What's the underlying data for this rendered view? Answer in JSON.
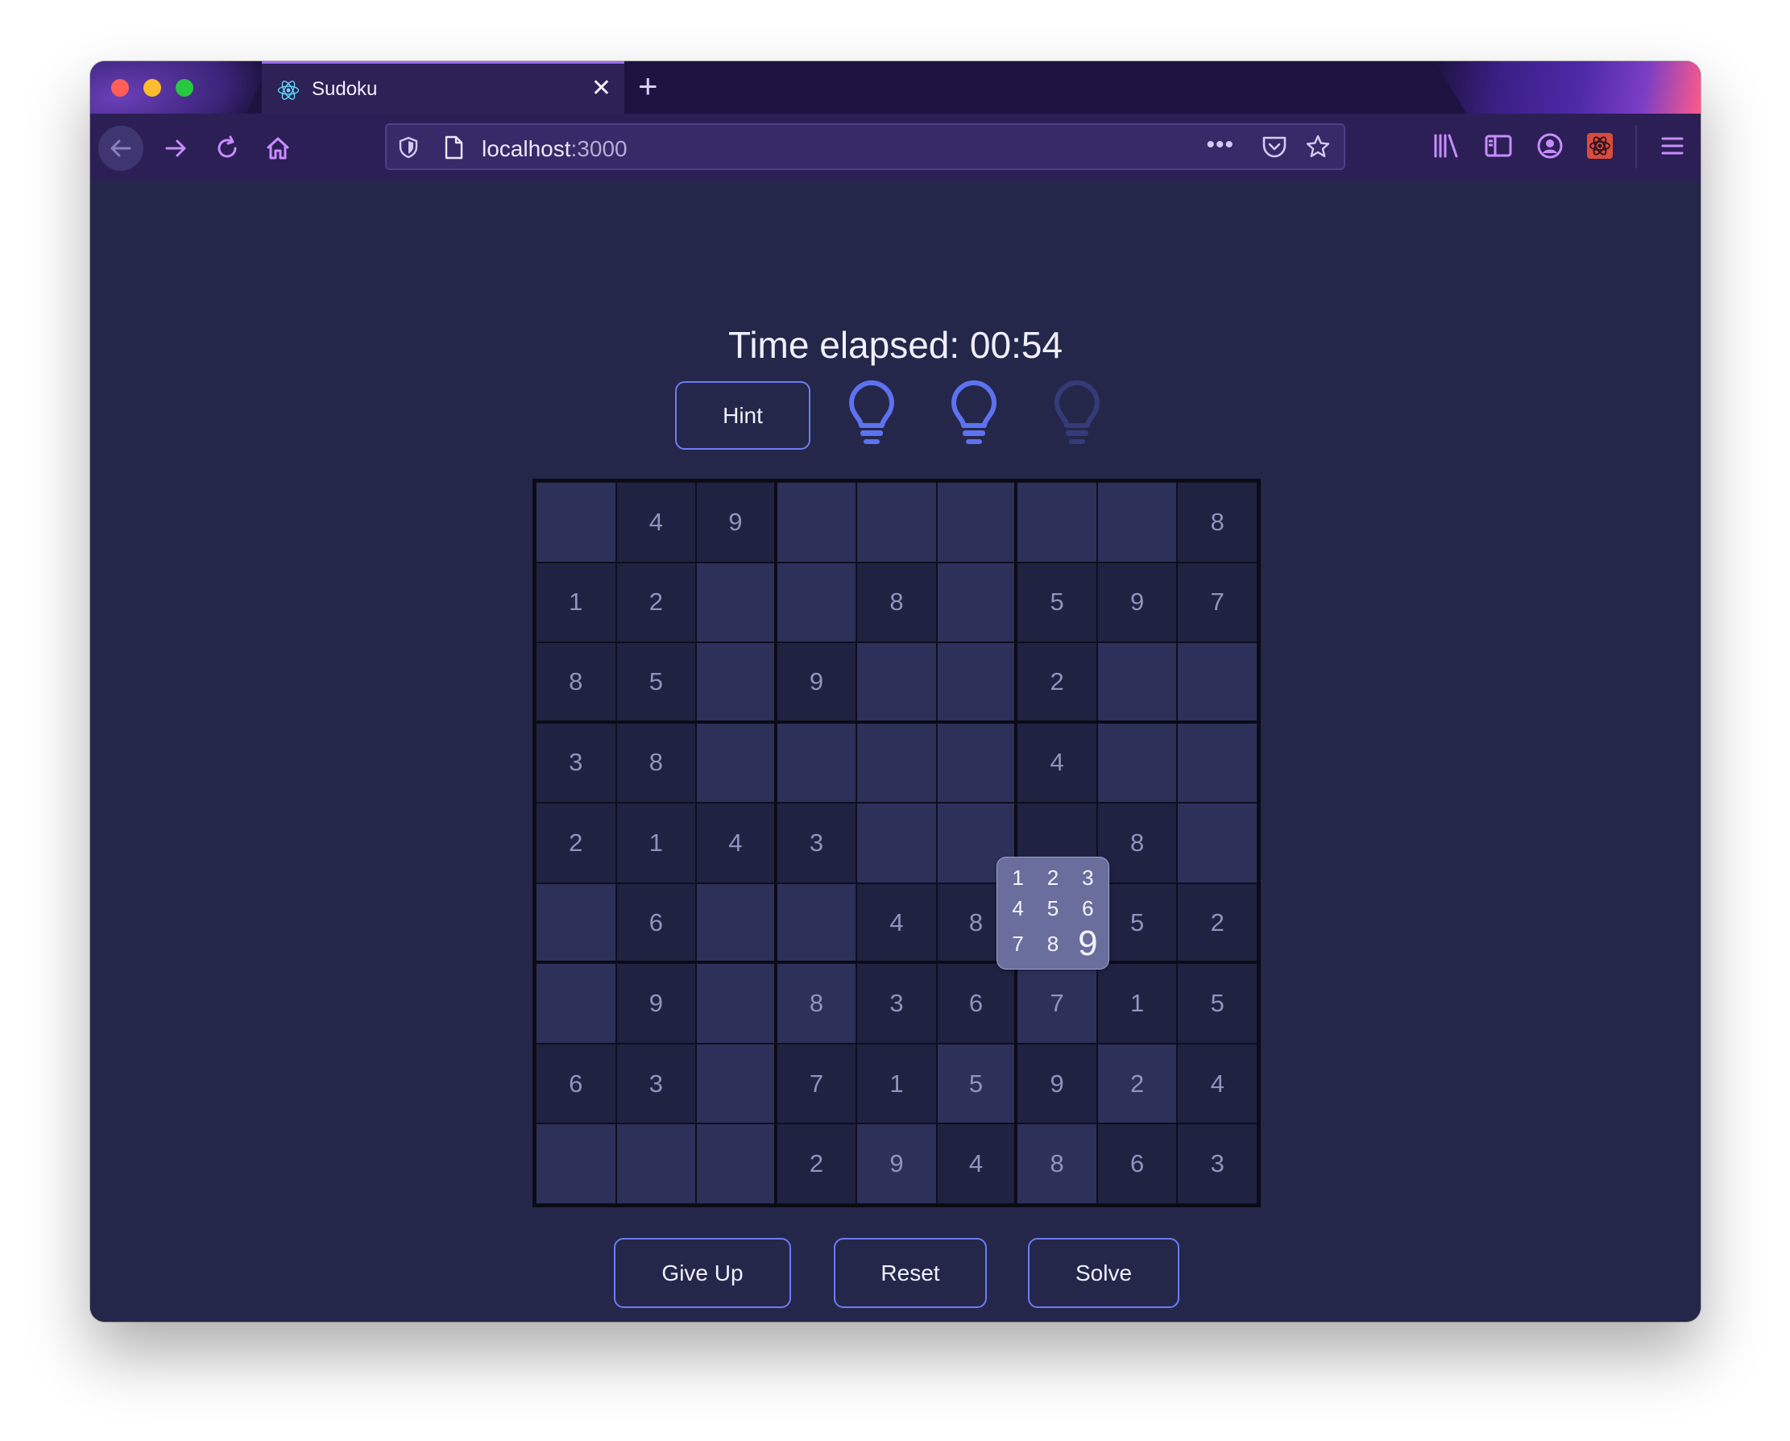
{
  "browser": {
    "tab_title": "Sudoku",
    "tab_close": "✕",
    "new_tab": "+",
    "url_host": "localhost",
    "url_port": ":3000",
    "more": "•••"
  },
  "game": {
    "timer_text": "Time elapsed: 00:54",
    "hint_label": "Hint",
    "hints_remaining": 2,
    "hints_total": 3,
    "buttons": {
      "give_up": "Give Up",
      "reset": "Reset",
      "solve": "Solve"
    }
  },
  "board": [
    [
      "",
      "4",
      "9",
      "",
      "",
      "",
      "",
      "",
      "8"
    ],
    [
      "1",
      "2",
      "",
      "",
      "8",
      "",
      "5",
      "9",
      "7"
    ],
    [
      "8",
      "5",
      "",
      "9",
      "",
      "",
      "2",
      "",
      ""
    ],
    [
      "3",
      "8",
      "",
      "",
      "",
      "",
      "4",
      "",
      ""
    ],
    [
      "2",
      "1",
      "4",
      "3",
      "",
      "",
      "",
      "8",
      ""
    ],
    [
      "",
      "6",
      "",
      "",
      "4",
      "8",
      "",
      "5",
      "2"
    ],
    [
      "",
      "9",
      "",
      "8",
      "3",
      "6",
      "7",
      "1",
      "5"
    ],
    [
      "6",
      "3",
      "",
      "7",
      "1",
      "5",
      "9",
      "2",
      "4"
    ],
    [
      "",
      "",
      "",
      "2",
      "9",
      "4",
      "8",
      "6",
      "3"
    ]
  ],
  "cell_shades": [
    [
      "l",
      "d",
      "d",
      "l",
      "l",
      "l",
      "l",
      "l",
      "d"
    ],
    [
      "d",
      "d",
      "l",
      "l",
      "d",
      "l",
      "d",
      "d",
      "d"
    ],
    [
      "d",
      "d",
      "l",
      "d",
      "l",
      "l",
      "d",
      "l",
      "l"
    ],
    [
      "d",
      "d",
      "l",
      "l",
      "l",
      "l",
      "d",
      "l",
      "l"
    ],
    [
      "d",
      "d",
      "d",
      "d",
      "l",
      "l",
      "d",
      "d",
      "l"
    ],
    [
      "l",
      "d",
      "l",
      "l",
      "d",
      "d",
      "l",
      "d",
      "d"
    ],
    [
      "l",
      "d",
      "l",
      "l",
      "d",
      "d",
      "l",
      "d",
      "d"
    ],
    [
      "d",
      "d",
      "l",
      "d",
      "d",
      "l",
      "d",
      "l",
      "d"
    ],
    [
      "l",
      "l",
      "l",
      "d",
      "l",
      "d",
      "l",
      "d",
      "d"
    ]
  ],
  "colors": {
    "cell_light": "#2d3059",
    "cell_dark": "#1f2240",
    "cell_selected": "#363b6e",
    "accent": "#6d7cf2",
    "bulb_active": "#5d72f0",
    "bulb_used": "#353b78"
  },
  "number_picker": {
    "numbers": [
      "1",
      "2",
      "3",
      "4",
      "5",
      "6",
      "7",
      "8",
      "9"
    ],
    "highlighted": "9"
  }
}
